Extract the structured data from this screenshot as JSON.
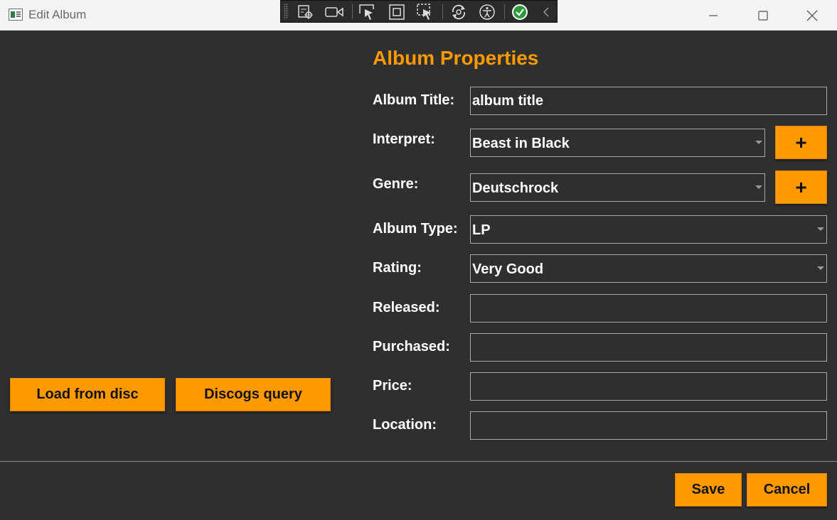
{
  "window": {
    "title": "Edit Album",
    "minimize_icon": "minimize-icon",
    "maximize_icon": "maximize-icon",
    "close_icon": "close-icon"
  },
  "debug_toolbar": {
    "tools": [
      "live-visual-tree-icon",
      "record-icon",
      "select-element-icon",
      "display-layout-adorners-icon",
      "track-focus-icon",
      "hot-reload-icon",
      "accessibility-icon",
      "binding-ok-icon",
      "collapse-chevron-icon"
    ]
  },
  "section_title": "Album Properties",
  "form": {
    "album_title": {
      "label": "Album Title:",
      "value": "album title"
    },
    "interpret": {
      "label": "Interpret:",
      "value": "Beast in Black",
      "add_label": "+"
    },
    "genre": {
      "label": "Genre:",
      "value": "Deutschrock",
      "add_label": "+"
    },
    "album_type": {
      "label": "Album Type:",
      "value": "LP"
    },
    "rating": {
      "label": "Rating:",
      "value": "Very Good"
    },
    "released": {
      "label": "Released:",
      "value": ""
    },
    "purchased": {
      "label": "Purchased:",
      "value": ""
    },
    "price": {
      "label": "Price:",
      "value": ""
    },
    "location": {
      "label": "Location:",
      "value": ""
    }
  },
  "left_buttons": {
    "load_from_disc": "Load from disc",
    "discogs_query": "Discogs query"
  },
  "footer": {
    "save": "Save",
    "cancel": "Cancel"
  },
  "colors": {
    "accent": "#ff9900",
    "background": "#2f2f2f",
    "text": "#ffffff",
    "field_border": "#aaaaaa"
  }
}
